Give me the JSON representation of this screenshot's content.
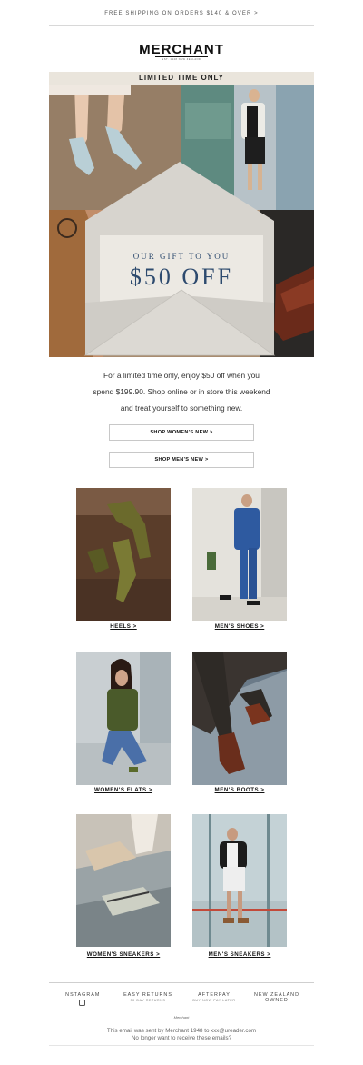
{
  "topbar": {
    "text": "FREE SHIPPING ON ORDERS $140 & OVER >"
  },
  "brand": {
    "name": "MERCHANT",
    "tagline": "EST. 1948 NEW ZEALAND"
  },
  "banner": {
    "text": "LIMITED TIME ONLY"
  },
  "hero": {
    "line1": "OUR GIFT TO YOU",
    "line2": "$50 OFF"
  },
  "intro": {
    "line1": "For a limited time only, enjoy $50 off when you",
    "line2": "spend $199.90. Shop online or in store this weekend",
    "line3": "and treat yourself to something new."
  },
  "buttons": {
    "womens": "SHOP WOMEN'S NEW >",
    "mens": "SHOP MEN'S NEW >"
  },
  "categories": [
    {
      "label": "HEELS >"
    },
    {
      "label": "MEN'S SHOES >"
    },
    {
      "label": "WOMEN'S FLATS >"
    },
    {
      "label": "MEN'S BOOTS >"
    },
    {
      "label": "WOMEN'S SNEAKERS >"
    },
    {
      "label": "MEN'S SNEAKERS >"
    }
  ],
  "footer": {
    "instagram": "INSTAGRAM",
    "returns": "EASY RETURNS",
    "returns_sub": "30 DAY RETURNS",
    "afterpay": "AFTERPAY",
    "afterpay_sub": "BUY NOW PAY LATER",
    "nz_line1": "NEW ZEALAND",
    "nz_line2": "OWNED",
    "mini_logo": "Merchant",
    "sent_by": "This email was sent by Merchant 1948 to xxx@ureader.com",
    "unsubscribe": "No longer want to receive these emails?"
  },
  "colors": {
    "banner_bg": "#eae5dc",
    "accent": "#2d4a6e"
  }
}
